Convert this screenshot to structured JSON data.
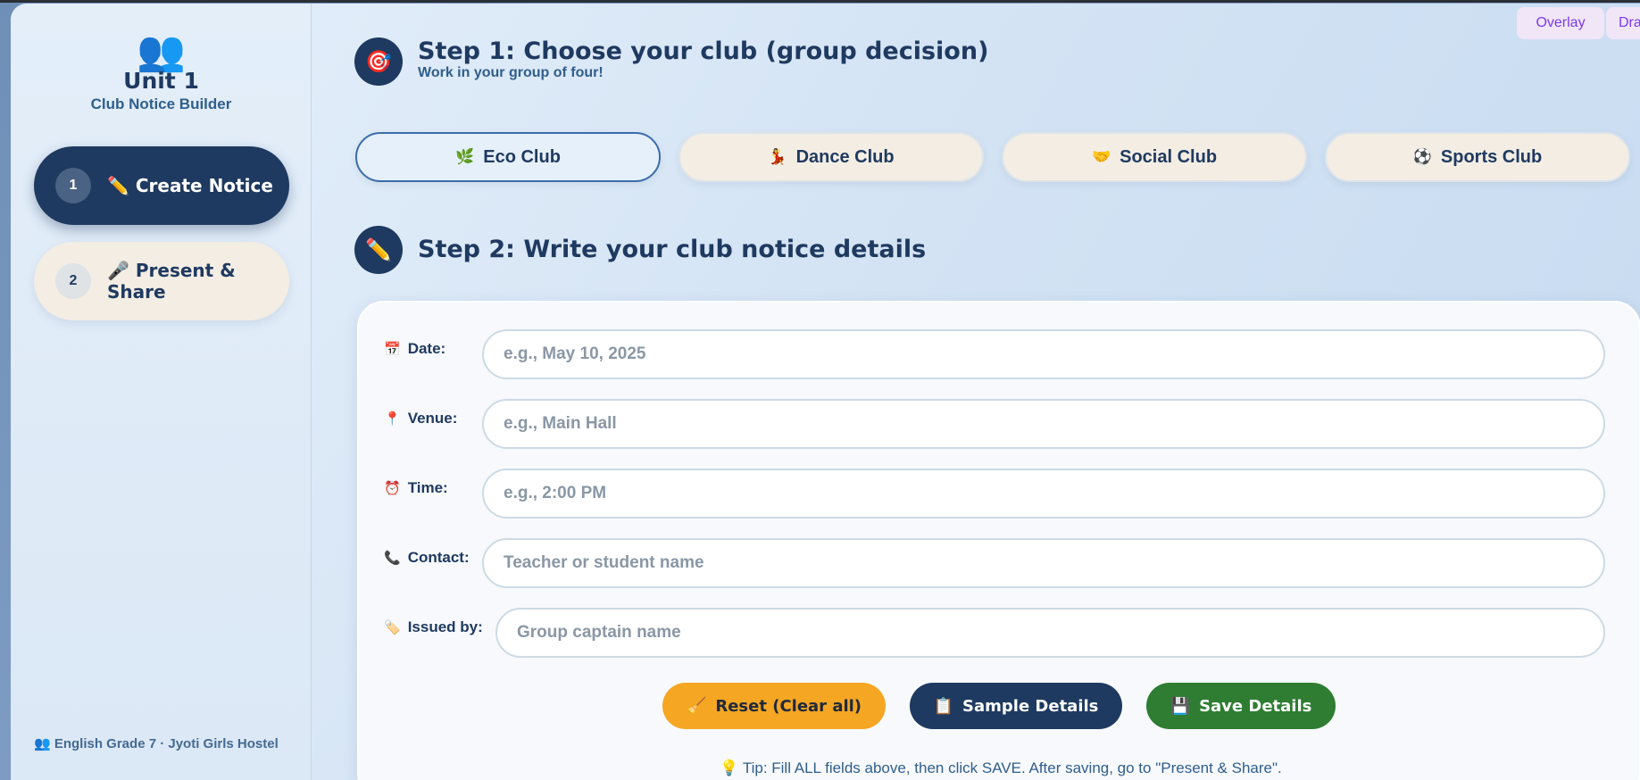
{
  "sidebar": {
    "brand_icon": "👥",
    "brand_title": "Unit 1",
    "brand_subtitle": "Club Notice Builder",
    "items": [
      {
        "number": "1",
        "icon": "✏️",
        "label": "Create Notice"
      },
      {
        "number": "2",
        "icon": "🎤",
        "label": "Present & Share"
      }
    ],
    "footer": "👥 English Grade 7 · Jyoti Girls Hostel"
  },
  "step1": {
    "icon": "🎯",
    "title": "Step 1: Choose your club (group decision)",
    "subtitle": "Work in your group of four!"
  },
  "clubs": [
    {
      "icon": "🌿",
      "label": "Eco Club",
      "selected": true
    },
    {
      "icon": "💃",
      "label": "Dance Club",
      "selected": false
    },
    {
      "icon": "🤝",
      "label": "Social Club",
      "selected": false
    },
    {
      "icon": "⚽",
      "label": "Sports Club",
      "selected": false
    }
  ],
  "step2": {
    "icon": "✏️",
    "title": "Step 2: Write your club notice details"
  },
  "form": {
    "date": {
      "icon": "📅",
      "label": "Date:",
      "placeholder": "e.g., May 10, 2025",
      "value": ""
    },
    "venue": {
      "icon": "📍",
      "label": "Venue:",
      "placeholder": "e.g., Main Hall",
      "value": ""
    },
    "time": {
      "icon": "⏰",
      "label": "Time:",
      "placeholder": "e.g., 2:00 PM",
      "value": ""
    },
    "contact": {
      "icon": "📞",
      "label": "Contact:",
      "placeholder": "Teacher or student name",
      "value": ""
    },
    "issued_by": {
      "icon": "🏷️",
      "label": "Issued by:",
      "placeholder": "Group captain name",
      "value": ""
    }
  },
  "actions": {
    "reset": {
      "icon": "🧹",
      "label": "Reset (Clear all)"
    },
    "sample": {
      "icon": "📋",
      "label": "Sample Details"
    },
    "save": {
      "icon": "💾",
      "label": "Save Details"
    }
  },
  "tip": "💡 Tip: Fill ALL fields above, then click SAVE. After saving, go to \"Present & Share\".",
  "overlay_tabs": [
    "Overlay",
    "Dra"
  ],
  "colors": {
    "navy": "#1e3a60",
    "reset": "#f5a623",
    "save": "#2e7d32",
    "overlay_text": "#7c3aed"
  }
}
